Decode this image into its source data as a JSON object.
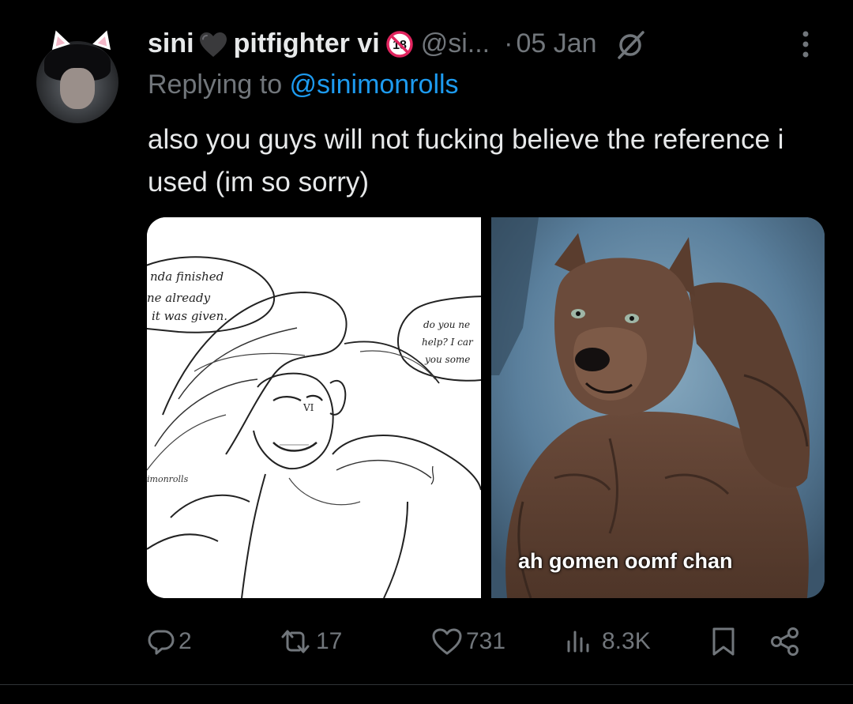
{
  "tweet": {
    "display_name_part1": "sini",
    "display_name_part2": "pitfighter vi",
    "handle": "@si...",
    "separator": "·",
    "date": "05 Jan",
    "replying_prefix": "Replying to ",
    "replying_mention": "@sinimonrolls",
    "text": "also you guys will not fucking believe the reference i used (im so sorry)"
  },
  "media": {
    "right_caption": "ah gomen oomf chan"
  },
  "actions": {
    "replies": "2",
    "reposts": "17",
    "likes": "731",
    "views": "8.3K"
  },
  "colors": {
    "background": "#000000",
    "text": "#e7e9ea",
    "muted": "#71767b",
    "accent": "#1d9bf0"
  },
  "icons": {
    "heart": "black-heart-icon",
    "age": "no-under-18-icon",
    "mute": "mute-icon",
    "more": "more-vertical-icon",
    "reply": "reply-icon",
    "repost": "repost-icon",
    "like": "like-icon",
    "views": "views-icon",
    "bookmark": "bookmark-icon",
    "share": "share-icon"
  }
}
